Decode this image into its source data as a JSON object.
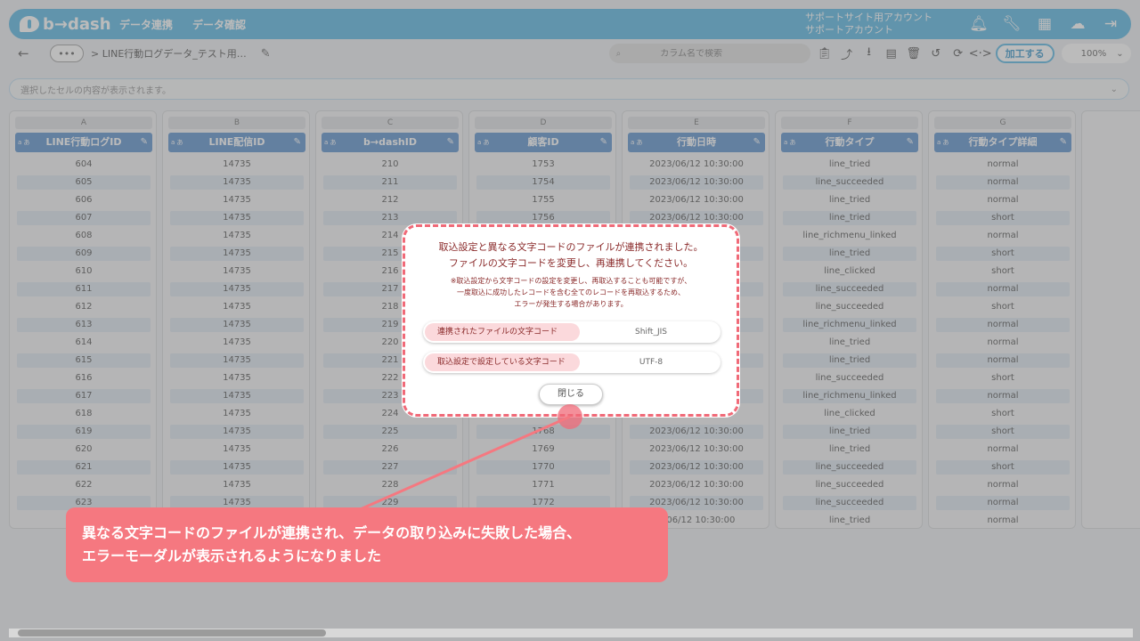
{
  "app": {
    "logo_text": "b→dash",
    "nav": [
      "データ連携",
      "データ確認"
    ],
    "account_line1": "サポートサイト用アカウント",
    "account_line2": "サポートアカウント"
  },
  "toolbar": {
    "more_label": "•••",
    "breadcrumb": "> LINE行動ログデータ_テスト用…",
    "search_placeholder": "カラム名で検索",
    "process_label": "加工する",
    "zoom": "100%"
  },
  "cellbar": {
    "text": "選択したセルの内容が表示されます。"
  },
  "grid": {
    "column_type_label": "a あ",
    "columns": [
      {
        "letter": "A",
        "header": "LINE行動ログID",
        "values": [
          "604",
          "605",
          "606",
          "607",
          "608",
          "609",
          "610",
          "611",
          "612",
          "613",
          "614",
          "615",
          "616",
          "617",
          "618",
          "619",
          "620",
          "621",
          "622",
          "623"
        ]
      },
      {
        "letter": "B",
        "header": "LINE配信ID",
        "values": [
          "14735",
          "14735",
          "14735",
          "14735",
          "14735",
          "14735",
          "14735",
          "14735",
          "14735",
          "14735",
          "14735",
          "14735",
          "14735",
          "14735",
          "14735",
          "14735",
          "14735",
          "14735",
          "14735",
          "14735"
        ]
      },
      {
        "letter": "C",
        "header": "b→dashID",
        "values": [
          "210",
          "211",
          "212",
          "213",
          "214",
          "215",
          "216",
          "217",
          "218",
          "219",
          "220",
          "221",
          "222",
          "223",
          "224",
          "225",
          "226",
          "227",
          "228",
          "229"
        ]
      },
      {
        "letter": "D",
        "header": "顧客ID",
        "values": [
          "1753",
          "1754",
          "1755",
          "1756",
          "",
          "",
          "",
          "",
          "",
          "",
          "",
          "",
          "",
          "",
          "",
          "1768",
          "1769",
          "1770",
          "1771",
          "1772"
        ]
      },
      {
        "letter": "E",
        "header": "行動日時",
        "values": [
          "2023/06/12 10:30:00",
          "2023/06/12 10:30:00",
          "2023/06/12 10:30:00",
          "2023/06/12 10:30:00",
          "00",
          "00",
          "00",
          "00",
          "00",
          "00",
          "00",
          "00",
          "00",
          "00",
          "00",
          "2023/06/12 10:30:00",
          "2023/06/12 10:30:00",
          "2023/06/12 10:30:00",
          "2023/06/12 10:30:00",
          "2023/06/12 10:30:00",
          "3/06/12 10:30:00"
        ]
      },
      {
        "letter": "F",
        "header": "行動タイプ",
        "values": [
          "line_tried",
          "line_succeeded",
          "line_tried",
          "line_tried",
          "line_richmenu_linked",
          "line_tried",
          "line_clicked",
          "line_succeeded",
          "line_succeeded",
          "line_richmenu_linked",
          "line_tried",
          "line_tried",
          "line_succeeded",
          "line_richmenu_linked",
          "line_clicked",
          "line_tried",
          "line_tried",
          "line_succeeded",
          "line_succeeded",
          "line_succeeded",
          "line_tried"
        ]
      },
      {
        "letter": "G",
        "header": "行動タイプ詳細",
        "values": [
          "normal",
          "normal",
          "normal",
          "short",
          "normal",
          "short",
          "short",
          "normal",
          "short",
          "normal",
          "normal",
          "normal",
          "short",
          "normal",
          "short",
          "short",
          "normal",
          "short",
          "normal",
          "normal",
          "normal"
        ]
      }
    ]
  },
  "modal": {
    "title_line1": "取込設定と異なる文字コードのファイルが連携されました。",
    "title_line2": "ファイルの文字コードを変更し、再連携してください。",
    "note_line1": "※取込設定から文字コードの設定を変更し、再取込することも可能ですが、",
    "note_line2": "一度取込に成功したレコードを含む全てのレコードを再取込するため、",
    "note_line3": "エラーが発生する場合があります。",
    "row1_label": "連携されたファイルの文字コード",
    "row1_value": "Shift_JIS",
    "row2_label": "取込設定で設定している文字コード",
    "row2_value": "UTF-8",
    "close_label": "閉じる"
  },
  "callout": {
    "line1": "異なる文字コードのファイルが連携され、データの取り込みに失敗した場合、",
    "line2": "エラーモーダルが表示されるようになりました"
  },
  "colors": {
    "brand": "#4bb0e0",
    "header_blue": "#4f88c8",
    "accent_pink": "#f57880"
  }
}
